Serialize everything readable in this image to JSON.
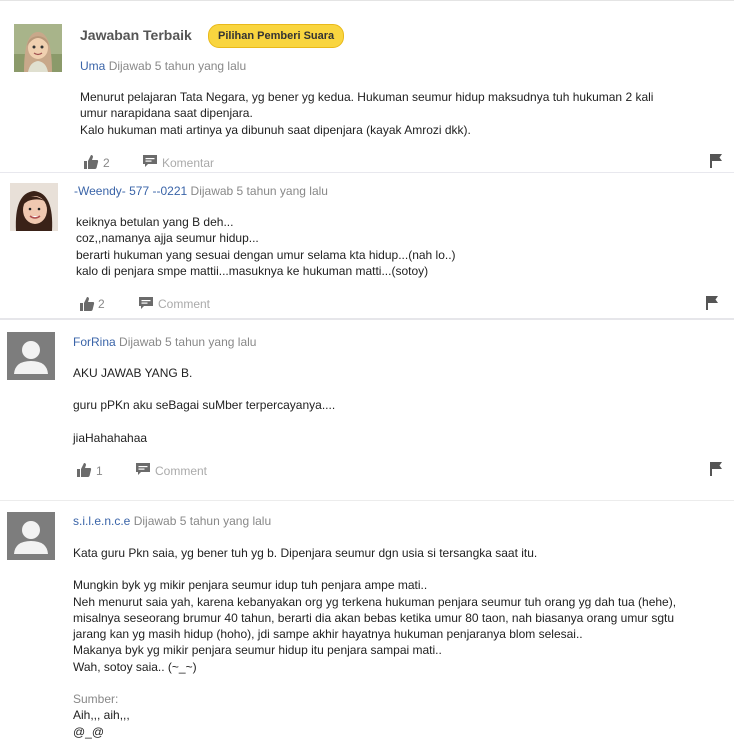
{
  "answers": [
    {
      "best_answer_title": "Jawaban Terbaik",
      "badge": "Pilihan Pemberi Suara",
      "user": "Uma",
      "meta": "Dijawab 5 tahun yang lalu",
      "lines": [
        "Menurut pelajaran Tata Negara, yg bener yg kedua. Hukuman seumur hidup maksudnya tuh hukuman 2 kali",
        "umur narapidana saat dipenjara.",
        "Kalo hukuman mati artinya ya dibunuh saat dipenjara (kayak Amrozi dkk)."
      ],
      "likes": "2",
      "comment_label": "Komentar"
    },
    {
      "user": "-Weendy- 577 --0221",
      "meta": "Dijawab 5 tahun yang lalu",
      "lines": [
        "keiknya betulan yang B deh...",
        "coz,,namanya ajja seumur hidup...",
        "berarti hukuman yang sesuai dengan umur selama kta hidup...(nah lo..)",
        "kalo di penjara smpe mattii...masuknya ke hukuman matti...(sotoy)"
      ],
      "likes": "2",
      "comment_label": "Comment"
    },
    {
      "user": "ForRina",
      "meta": "Dijawab 5 tahun yang lalu",
      "lines": [
        "AKU JAWAB YANG B.",
        "guru pPKn aku seBagai suMber terpercayanya....",
        "jiaHahahahaa"
      ],
      "likes": "1",
      "comment_label": "Comment"
    },
    {
      "user": "s.i.l.e.n.c.e",
      "meta": "Dijawab 5 tahun yang lalu",
      "lines": [
        "Kata guru Pkn saia, yg bener tuh yg b. Dipenjara seumur dgn usia si tersangka saat itu.",
        "Mungkin byk yg mikir penjara seumur idup tuh penjara ampe mati..",
        "Neh menurut saia yah, karena kebanyakan org yg terkena hukuman penjara seumur tuh orang yg dah tua (hehe),",
        "misalnya seseorang brumur 40 tahun, berarti dia akan bebas ketika umur 80 taon, nah biasanya orang umur sgtu",
        "jarang kan yg masih hidup (hoho), jdi sampe akhir hayatnya hukuman penjaranya blom selesai..",
        "Makanya byk yg mikir penjara seumur hidup itu penjara sampai mati..",
        "Wah, sotoy saia.. (~_~)"
      ],
      "source_label": "Sumber:",
      "source_lines": [
        "Aih,,, aih,,,",
        "@_@"
      ]
    }
  ],
  "icons": {
    "thumb": "thumbs-up-icon",
    "comment": "comment-bubble-icon",
    "flag": "flag-icon",
    "default_avatar": "user-silhouette-icon"
  },
  "colors": {
    "link": "#3a64a8",
    "badge": "#f9d53f",
    "muted": "#888888",
    "icon": "#6b6b6b"
  }
}
